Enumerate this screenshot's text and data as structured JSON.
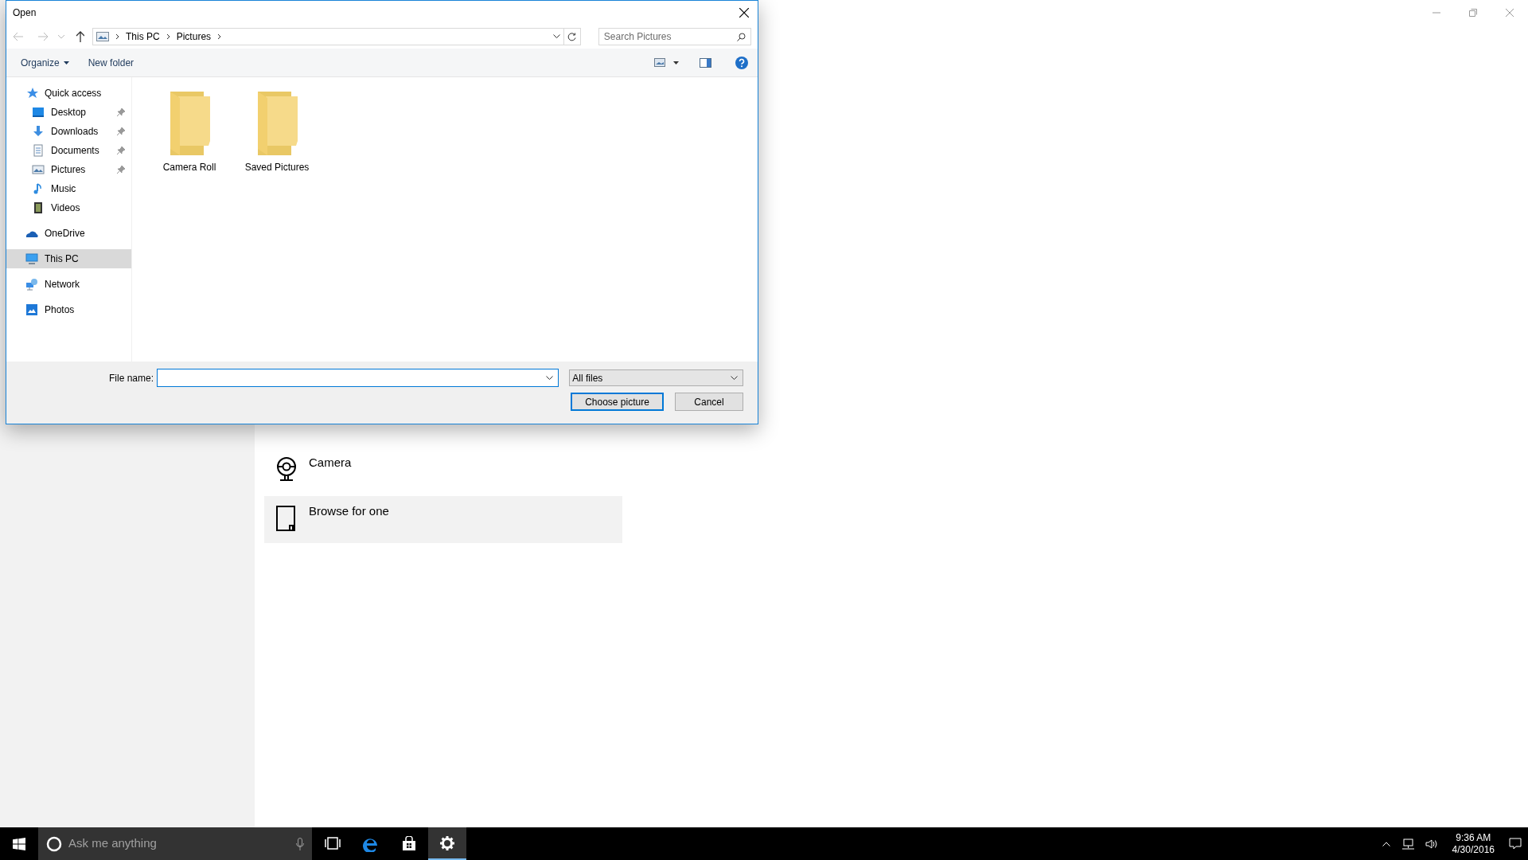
{
  "settings_window": {
    "options": [
      {
        "label": "Camera",
        "kind": "camera",
        "selected": false
      },
      {
        "label": "Browse for one",
        "kind": "browse",
        "selected": true
      }
    ]
  },
  "dialog": {
    "title": "Open",
    "breadcrumb": [
      "This PC",
      "Pictures"
    ],
    "search": {
      "placeholder": "Search Pictures"
    },
    "toolbar": [
      "Organize",
      "New folder"
    ],
    "nav": [
      {
        "label": "Quick access",
        "kind": "star",
        "selected": false,
        "children": [
          {
            "label": "Desktop",
            "kind": "desktop",
            "pinned": true,
            "selected": false
          },
          {
            "label": "Downloads",
            "kind": "downloads",
            "pinned": true,
            "selected": false
          },
          {
            "label": "Documents",
            "kind": "documents",
            "pinned": true,
            "selected": false
          },
          {
            "label": "Pictures",
            "kind": "pictures",
            "pinned": true,
            "selected": false
          },
          {
            "label": "Music",
            "kind": "music",
            "pinned": false,
            "selected": false
          },
          {
            "label": "Videos",
            "kind": "videos",
            "pinned": false,
            "selected": false
          }
        ]
      },
      {
        "label": "OneDrive",
        "kind": "cloud",
        "selected": false
      },
      {
        "label": "This PC",
        "kind": "pc",
        "selected": true
      },
      {
        "label": "Network",
        "kind": "network",
        "selected": false
      },
      {
        "label": "Photos",
        "kind": "photos",
        "selected": false
      }
    ],
    "folders": [
      "Camera Roll",
      "Saved Pictures"
    ],
    "file_name_label": "File name:",
    "file_type": "All files",
    "buttons": [
      {
        "label": "Choose picture",
        "kind": "default"
      },
      {
        "label": "Cancel",
        "kind": "normal"
      }
    ]
  },
  "taskbar": {
    "search": {
      "placeholder": "Ask me anything"
    },
    "apps": [
      {
        "kind": "taskview",
        "active": false
      },
      {
        "kind": "edge",
        "active": false
      },
      {
        "kind": "store",
        "active": false
      },
      {
        "kind": "settings",
        "active": true
      }
    ],
    "time": "9:36 AM",
    "date": "4/30/2016"
  }
}
